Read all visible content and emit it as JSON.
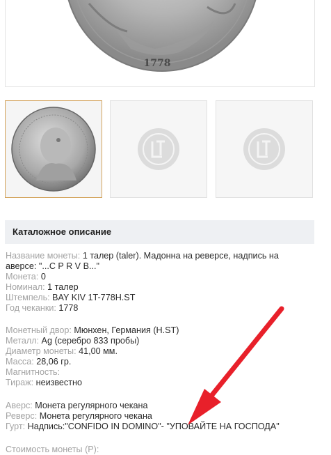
{
  "coin_image": {
    "date_text": "1778"
  },
  "catalog_header": "Каталожное описание",
  "specs": {
    "name_label": "Название монеты:",
    "name_value": "1 талер (taler). Мадонна на реверсе, надпись на аверсе: \"...C P R V B...\"",
    "coin_label": "Монета:",
    "coin_value": "0",
    "nominal_label": "Номинал:",
    "nominal_value": "1 талер",
    "stamp_label": "Штемпель:",
    "stamp_value": "BAY KIV 1T-778H.ST",
    "year_label": "Год чеканки:",
    "year_value": "1778",
    "mint_label": "Монетный двор:",
    "mint_value": "Мюнхен, Германия (H.ST)",
    "metal_label": "Металл:",
    "metal_value": "Ag (серебро 833 пробы)",
    "diameter_label": "Диаметр монеты:",
    "diameter_value": "41,00 мм.",
    "mass_label": "Масса:",
    "mass_value": "28,06 гр.",
    "magnet_label": "Магнитность:",
    "magnet_value": "",
    "mintage_label": "Тираж:",
    "mintage_value": "неизвестно",
    "obverse_label": "Аверс:",
    "obverse_value": "Монета регулярного чекана",
    "reverse_label": "Реверс:",
    "reverse_value": "Монета регулярного чекана",
    "edge_label": "Гурт:",
    "edge_value": "Надпись:\"CONFIDO IN DOMINO\"- \"УПОВАЙТЕ НА ГОСПОДА\"",
    "price_label": "Стоимость монеты (Р):"
  },
  "colors": {
    "accent": "#d3a35c",
    "arrow": "#e8202a"
  }
}
